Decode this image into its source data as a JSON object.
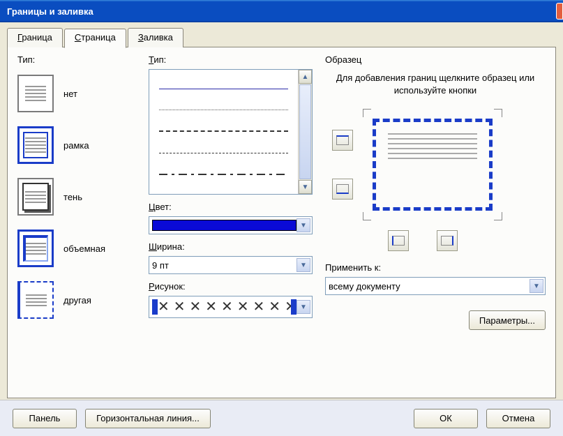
{
  "window": {
    "title": "Границы и заливка"
  },
  "tabs": [
    {
      "label": "Граница",
      "underlined": "Г",
      "rest": "раница"
    },
    {
      "label": "Страница",
      "underlined": "С",
      "rest": "траница"
    },
    {
      "label": "Заливка",
      "underlined": "З",
      "rest": "аливка"
    }
  ],
  "active_tab": 1,
  "left": {
    "label": "Тип:",
    "items": [
      {
        "text": "нет",
        "underlined": "н",
        "rest": "ет"
      },
      {
        "text": "рамка",
        "underlined": "р",
        "rest": "амка"
      },
      {
        "text": "тень",
        "underlined": "т",
        "rest": "ень"
      },
      {
        "text": "объемная",
        "underlined": "о",
        "rest": "бъемная"
      },
      {
        "text": "другая",
        "underlined": "д",
        "rest": "ругая"
      }
    ]
  },
  "mid": {
    "style_label": "Тип:",
    "style_u": "Т",
    "style_rest": "ип:",
    "color_label": "Цвет:",
    "color_u": "Ц",
    "color_rest": "вет:",
    "color_value": "#0a0ad6",
    "width_label": "Ширина:",
    "width_u": "Ш",
    "width_rest": "ирина:",
    "width_value": "9 пт",
    "art_label": "Рисунок:",
    "art_u": "Р",
    "art_rest": "исунок:"
  },
  "right": {
    "sample_label": "Образец",
    "hint": "Для добавления границ щелкните образец или используйте кнопки",
    "apply_label": "Применить к:",
    "apply_u": "",
    "apply_rest": "Применить к:",
    "apply_value": "всему документу",
    "params_label": "Параметры..."
  },
  "footer": {
    "panel": "Панель",
    "hline": "Горизонтальная линия...",
    "ok": "ОК",
    "cancel": "Отмена"
  }
}
